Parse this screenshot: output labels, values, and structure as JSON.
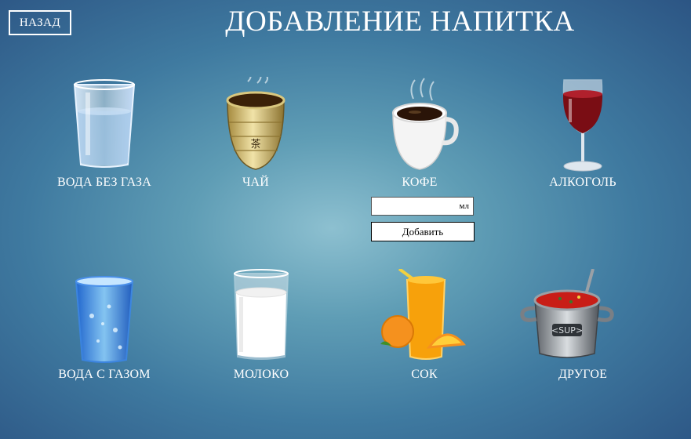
{
  "header": {
    "back_label": "НАЗАД",
    "title": "ДОБАВЛЕНИЕ НАПИТКА"
  },
  "drinks": [
    {
      "label": "ВОДА БЕЗ ГАЗА",
      "icon": "water-glass-icon"
    },
    {
      "label": "ЧАЙ",
      "icon": "tea-cup-icon"
    },
    {
      "label": "КОФЕ",
      "icon": "coffee-cup-icon"
    },
    {
      "label": "АЛКОГОЛЬ",
      "icon": "wine-glass-icon"
    },
    {
      "label": "ВОДА С ГАЗОМ",
      "icon": "sparkling-water-icon"
    },
    {
      "label": "МОЛОКО",
      "icon": "milk-glass-icon"
    },
    {
      "label": "СОК",
      "icon": "juice-glass-icon"
    },
    {
      "label": "ДРУГОЕ",
      "icon": "soup-pot-icon"
    }
  ],
  "amount_form": {
    "unit": "мл",
    "add_label": "Добавить"
  },
  "colors": {
    "background_center": "#8dc0d0",
    "background_edge": "#2c5584",
    "text": "#ffffff"
  }
}
